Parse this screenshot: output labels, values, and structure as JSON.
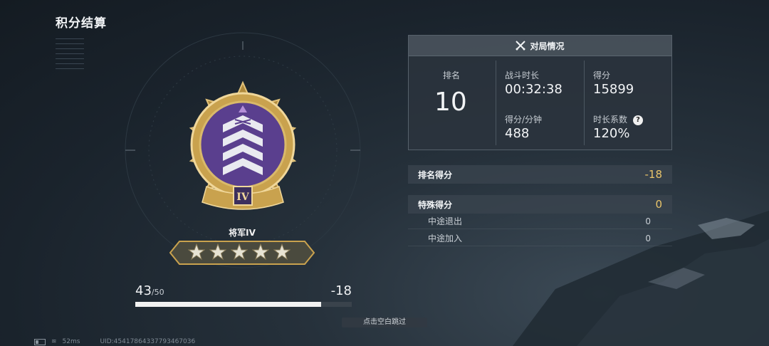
{
  "page_title": "积分结算",
  "rank": {
    "name": "将军IV",
    "numeral": "IV",
    "stars": 5,
    "points_current": "43",
    "points_max": "/50",
    "points_change": "-18",
    "progress_fraction": 0.86
  },
  "match_panel": {
    "title": "对局情况",
    "rank_label": "排名",
    "rank_value": "10",
    "duration_label": "战斗时长",
    "duration_value": "00:32:38",
    "score_label": "得分",
    "score_value": "15899",
    "spm_label": "得分/分钟",
    "spm_value": "488",
    "coef_label": "时长系数",
    "coef_value": "120%",
    "help_glyph": "?"
  },
  "breakdown": {
    "rank_points_label": "排名得分",
    "rank_points_value": "-18",
    "special_label": "特殊得分",
    "special_value": "0",
    "items": [
      {
        "label": "中途退出",
        "value": "0"
      },
      {
        "label": "中途加入",
        "value": "0"
      }
    ]
  },
  "skip_label": "点击空白跳过",
  "status": {
    "ping": "52ms",
    "uid": "UID:4541786433779346703​6"
  },
  "colors": {
    "accent_gold": "#e9c46a",
    "medal_purple": "#5a3f8e",
    "medal_gold": "#c9a24e"
  }
}
